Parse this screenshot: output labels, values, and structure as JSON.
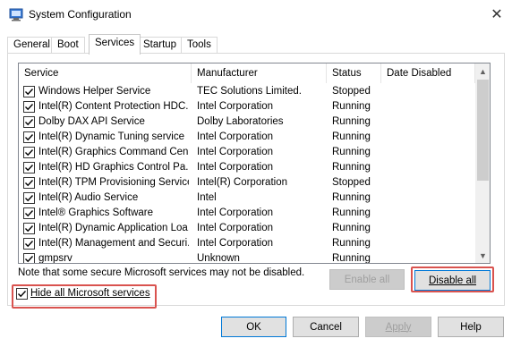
{
  "window": {
    "title": "System Configuration",
    "close_glyph": "✕",
    "icon": "system-config-icon"
  },
  "tabs": [
    {
      "label": "General",
      "active": false
    },
    {
      "label": "Boot",
      "active": false
    },
    {
      "label": "Services",
      "active": true
    },
    {
      "label": "Startup",
      "active": false
    },
    {
      "label": "Tools",
      "active": false
    }
  ],
  "services_list": {
    "columns": [
      "Service",
      "Manufacturer",
      "Status",
      "Date Disabled"
    ],
    "rows": [
      {
        "name": "Windows Helper Service",
        "manufacturer": "TEC Solutions Limited.",
        "status": "Stopped",
        "date_disabled": "",
        "checked": true
      },
      {
        "name": "Intel(R) Content Protection HDC...",
        "manufacturer": "Intel Corporation",
        "status": "Running",
        "date_disabled": "",
        "checked": true
      },
      {
        "name": "Dolby DAX API Service",
        "manufacturer": "Dolby Laboratories",
        "status": "Running",
        "date_disabled": "",
        "checked": true
      },
      {
        "name": "Intel(R) Dynamic Tuning service",
        "manufacturer": "Intel Corporation",
        "status": "Running",
        "date_disabled": "",
        "checked": true
      },
      {
        "name": "Intel(R) Graphics Command Cen...",
        "manufacturer": "Intel Corporation",
        "status": "Running",
        "date_disabled": "",
        "checked": true
      },
      {
        "name": "Intel(R) HD Graphics Control Pa...",
        "manufacturer": "Intel Corporation",
        "status": "Running",
        "date_disabled": "",
        "checked": true
      },
      {
        "name": "Intel(R) TPM Provisioning Service",
        "manufacturer": "Intel(R) Corporation",
        "status": "Stopped",
        "date_disabled": "",
        "checked": true
      },
      {
        "name": "Intel(R) Audio Service",
        "manufacturer": "Intel",
        "status": "Running",
        "date_disabled": "",
        "checked": true
      },
      {
        "name": "Intel® Graphics Software",
        "manufacturer": "Intel Corporation",
        "status": "Running",
        "date_disabled": "",
        "checked": true
      },
      {
        "name": "Intel(R) Dynamic Application Loa...",
        "manufacturer": "Intel Corporation",
        "status": "Running",
        "date_disabled": "",
        "checked": true
      },
      {
        "name": "Intel(R) Management and Securi...",
        "manufacturer": "Intel Corporation",
        "status": "Running",
        "date_disabled": "",
        "checked": true
      },
      {
        "name": "gmpsrv",
        "manufacturer": "Unknown",
        "status": "Running",
        "date_disabled": "",
        "checked": true
      }
    ]
  },
  "note": "Note that some secure Microsoft services may not be disabled.",
  "buttons": {
    "enable_all": "Enable all",
    "disable_all": "Disable all",
    "ok": "OK",
    "cancel": "Cancel",
    "apply": "Apply",
    "help": "Help"
  },
  "hide_ms": {
    "label": "Hide all Microsoft services",
    "checked": true
  },
  "colors": {
    "highlight": "#d9534f",
    "accent": "#0078d7"
  }
}
